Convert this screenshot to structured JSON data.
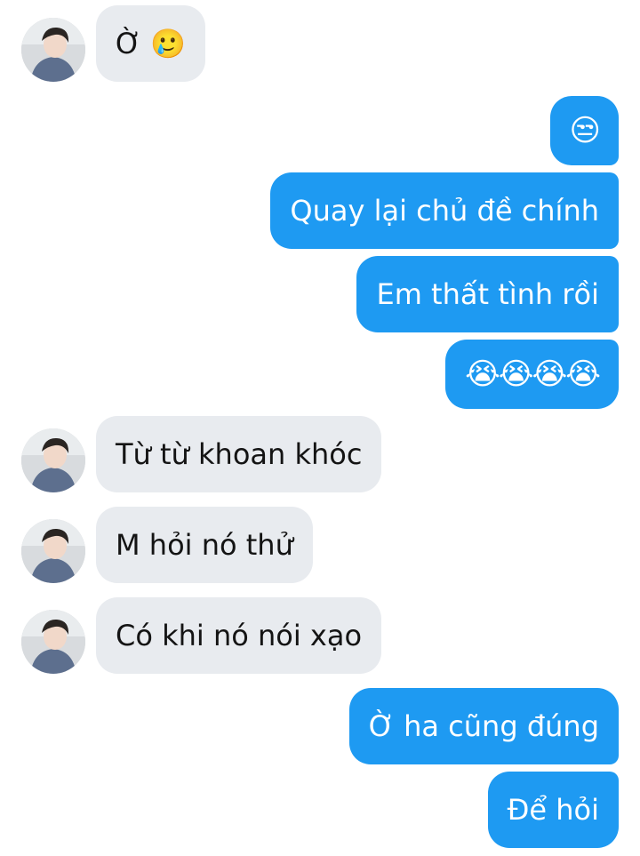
{
  "colors": {
    "outgoing_bubble": "#1e9af2",
    "incoming_bubble": "#e8ebef",
    "incoming_text": "#141414",
    "outgoing_text": "#ffffff"
  },
  "messages": [
    {
      "side": "incoming",
      "text": "Ờ 🥲",
      "avatar": "contact-avatar"
    },
    {
      "side": "outgoing",
      "text": "😒"
    },
    {
      "side": "outgoing",
      "text": "Quay lại chủ đề chính"
    },
    {
      "side": "outgoing",
      "text": "Em thất tình rồi"
    },
    {
      "side": "outgoing",
      "text": "😭😭😭😭"
    },
    {
      "side": "incoming",
      "text": "Từ từ khoan khóc",
      "avatar": "contact-avatar"
    },
    {
      "side": "incoming",
      "text": "M hỏi nó thử",
      "avatar": "contact-avatar"
    },
    {
      "side": "incoming",
      "text": "Có khi nó nói xạo",
      "avatar": "contact-avatar"
    },
    {
      "side": "outgoing",
      "text": "Ờ ha cũng đúng"
    },
    {
      "side": "outgoing",
      "text": "Để hỏi"
    }
  ]
}
